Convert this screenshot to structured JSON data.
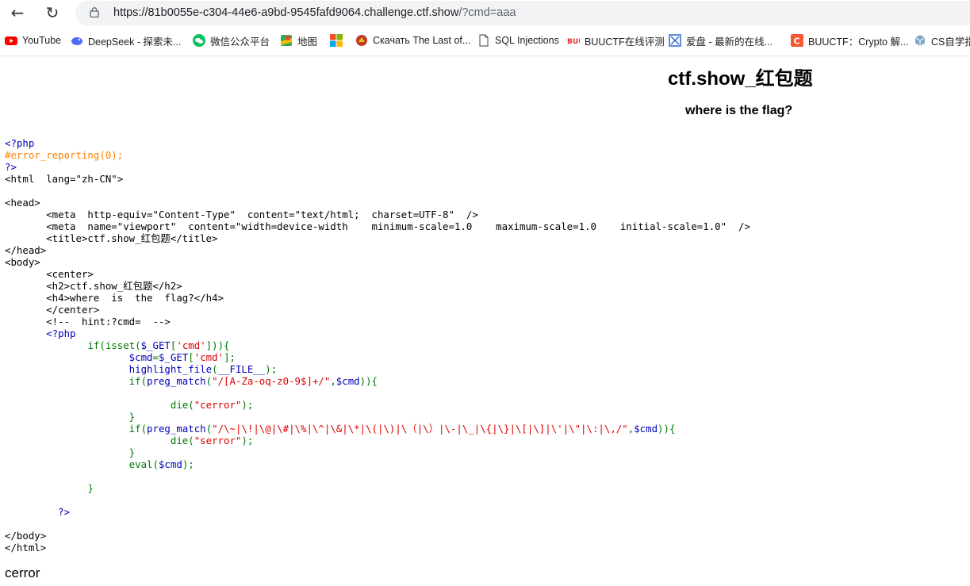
{
  "browser": {
    "url_main": "https://81b0055e-c304-44e6-a9bd-9545fafd9064.challenge.ctf.show",
    "url_query": "/?cmd=aaa",
    "bookmarks": [
      {
        "label": "YouTube",
        "icon": "youtube-icon"
      },
      {
        "label": "DeepSeek - 探索未...",
        "icon": "deepseek-icon"
      },
      {
        "label": "微信公众平台",
        "icon": "wechat-icon"
      },
      {
        "label": "地图",
        "icon": "maps-icon"
      },
      {
        "label": "",
        "icon": "microsoft-icon"
      },
      {
        "label": "Скачать The Last of...",
        "icon": "game-icon"
      },
      {
        "label": "SQL Injections",
        "icon": "document-icon"
      },
      {
        "label": "BUUCTF在线评测",
        "icon": "buuctf-icon"
      },
      {
        "label": "爱盘 - 最新的在线...",
        "icon": "aipan-icon"
      },
      {
        "label": "BUUCTF：Crypto 解...",
        "icon": "csdn-icon"
      },
      {
        "label": "CS自学指",
        "icon": "cube-icon"
      }
    ]
  },
  "page": {
    "title": "ctf.show_红包题",
    "subtitle": "where is the flag?",
    "source_lines": [
      [
        {
          "t": "<?php",
          "c": "blue"
        }
      ],
      [
        {
          "t": "#error_reporting(0);",
          "c": "orange"
        }
      ],
      [
        {
          "t": "?>",
          "c": "blue"
        }
      ],
      [
        {
          "t": "<html  lang=\"zh-CN\">",
          "c": ""
        }
      ],
      [],
      [
        {
          "t": "<head>",
          "c": ""
        }
      ],
      [
        {
          "t": "       <meta  http-equiv=\"Content-Type\"  content=\"text/html;  charset=UTF-8\"  />",
          "c": ""
        }
      ],
      [
        {
          "t": "       <meta  name=\"viewport\"  content=\"width=device-width    minimum-scale=1.0    maximum-scale=1.0    initial-scale=1.0\"  />",
          "c": ""
        }
      ],
      [
        {
          "t": "       <title>ctf.show_红包题</title>",
          "c": ""
        }
      ],
      [
        {
          "t": "</head>",
          "c": ""
        }
      ],
      [
        {
          "t": "<body>",
          "c": ""
        }
      ],
      [
        {
          "t": "       <center>",
          "c": ""
        }
      ],
      [
        {
          "t": "       <h2>ctf.show_红包题</h2>",
          "c": ""
        }
      ],
      [
        {
          "t": "       <h4>where  is  the  flag?</h4>",
          "c": ""
        }
      ],
      [
        {
          "t": "       </center>",
          "c": ""
        }
      ],
      [
        {
          "t": "       <!--  hint:?cmd=  -->",
          "c": ""
        }
      ],
      [
        {
          "t": "       ",
          "c": ""
        },
        {
          "t": "<?php",
          "c": "blue"
        }
      ],
      [
        {
          "t": "              ",
          "c": ""
        },
        {
          "t": "if(isset(",
          "c": "green"
        },
        {
          "t": "$_GET",
          "c": "blue"
        },
        {
          "t": "[",
          "c": "green"
        },
        {
          "t": "'cmd'",
          "c": "red"
        },
        {
          "t": "])){",
          "c": "green"
        }
      ],
      [
        {
          "t": "                     ",
          "c": ""
        },
        {
          "t": "$cmd",
          "c": "blue"
        },
        {
          "t": "=",
          "c": "green"
        },
        {
          "t": "$_GET",
          "c": "blue"
        },
        {
          "t": "[",
          "c": "green"
        },
        {
          "t": "'cmd'",
          "c": "red"
        },
        {
          "t": "];",
          "c": "green"
        }
      ],
      [
        {
          "t": "                     ",
          "c": ""
        },
        {
          "t": "highlight_file",
          "c": "blue"
        },
        {
          "t": "(",
          "c": "green"
        },
        {
          "t": "__FILE__",
          "c": "blue"
        },
        {
          "t": ");",
          "c": "green"
        }
      ],
      [
        {
          "t": "                     ",
          "c": ""
        },
        {
          "t": "if(",
          "c": "green"
        },
        {
          "t": "preg_match",
          "c": "blue"
        },
        {
          "t": "(",
          "c": "green"
        },
        {
          "t": "\"/[A-Za-oq-z0-9$]+/\"",
          "c": "red"
        },
        {
          "t": ",",
          "c": "green"
        },
        {
          "t": "$cmd",
          "c": "blue"
        },
        {
          "t": ")){",
          "c": "green"
        }
      ],
      [],
      [
        {
          "t": "                            ",
          "c": ""
        },
        {
          "t": "die(",
          "c": "green"
        },
        {
          "t": "\"cerror\"",
          "c": "red"
        },
        {
          "t": ");",
          "c": "green"
        }
      ],
      [
        {
          "t": "                     ",
          "c": ""
        },
        {
          "t": "}",
          "c": "green"
        }
      ],
      [
        {
          "t": "                     ",
          "c": ""
        },
        {
          "t": "if(",
          "c": "green"
        },
        {
          "t": "preg_match",
          "c": "blue"
        },
        {
          "t": "(",
          "c": "green"
        },
        {
          "t": "\"/\\~|\\!|\\@|\\#|\\%|\\^|\\&|\\*|\\(|\\)|\\（|\\）|\\-|\\_|\\{|\\}|\\[|\\]|\\'|\\\"|\\:|\\,/\"",
          "c": "red"
        },
        {
          "t": ",",
          "c": "green"
        },
        {
          "t": "$cmd",
          "c": "blue"
        },
        {
          "t": ")){",
          "c": "green"
        }
      ],
      [
        {
          "t": "                            ",
          "c": ""
        },
        {
          "t": "die(",
          "c": "green"
        },
        {
          "t": "\"serror\"",
          "c": "red"
        },
        {
          "t": ");",
          "c": "green"
        }
      ],
      [
        {
          "t": "                     ",
          "c": ""
        },
        {
          "t": "}",
          "c": "green"
        }
      ],
      [
        {
          "t": "                     ",
          "c": ""
        },
        {
          "t": "eval(",
          "c": "green"
        },
        {
          "t": "$cmd",
          "c": "blue"
        },
        {
          "t": ");",
          "c": "green"
        }
      ],
      [],
      [
        {
          "t": "              ",
          "c": ""
        },
        {
          "t": "}",
          "c": "green"
        }
      ],
      [],
      [
        {
          "t": "         ",
          "c": ""
        },
        {
          "t": "?>",
          "c": "blue"
        }
      ],
      [],
      [
        {
          "t": "</body>",
          "c": ""
        }
      ],
      [
        {
          "t": "</html>",
          "c": ""
        }
      ]
    ],
    "output": "cerror"
  }
}
